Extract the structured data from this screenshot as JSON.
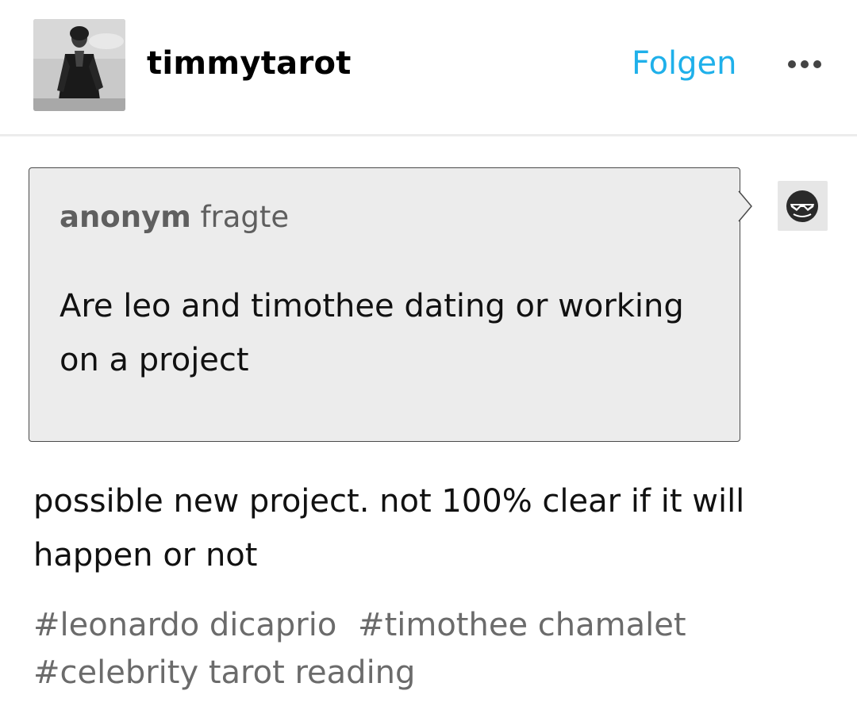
{
  "header": {
    "username": "timmytarot",
    "follow_label": "Folgen",
    "more_icon": "ellipsis-icon"
  },
  "ask": {
    "asker_name": "anonym",
    "asked_verb": "fragte",
    "question": "Are leo and timothee dating or working on a project",
    "asker_avatar_icon": "sunglasses-face-icon"
  },
  "answer": {
    "text": "possible new project. not 100% clear if it will happen or not"
  },
  "tags": [
    "#leonardo dicaprio",
    "#timothee chamalet",
    "#celebrity tarot reading"
  ],
  "colors": {
    "accent": "#1fb0ea",
    "ask_background": "#ececec",
    "tag_text": "#6b6b6b"
  }
}
